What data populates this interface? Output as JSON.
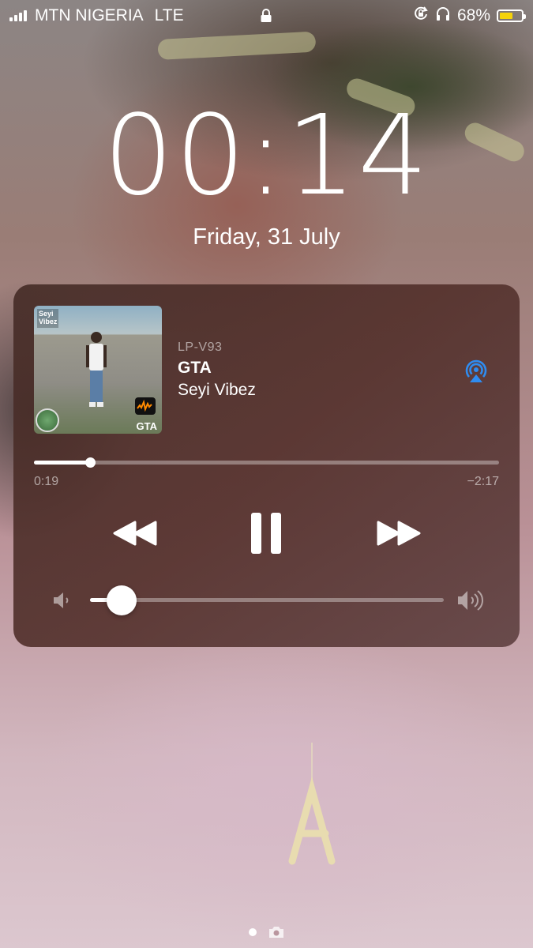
{
  "status_bar": {
    "carrier": "MTN NIGERIA",
    "network": "LTE",
    "battery_percent": "68%",
    "battery_level": 0.68,
    "battery_color": "#f5d20a",
    "icons": [
      "signal-bars-icon",
      "lock-icon",
      "rotation-lock-icon",
      "headphones-icon",
      "battery-icon"
    ]
  },
  "lock_screen": {
    "time": "00:14",
    "date": "Friday, 31 July"
  },
  "now_playing": {
    "artwork_text": "Seyi\nVibez",
    "artwork_badge": "GTA",
    "source": "LP-V93",
    "title": "GTA",
    "artist": "Seyi Vibez",
    "elapsed": "0:19",
    "remaining": "−2:17",
    "progress": 0.12,
    "volume": 0.09,
    "airplay_color": "#2f8cf0",
    "controls": [
      "rewind-icon",
      "pause-icon",
      "fast-forward-icon"
    ]
  },
  "page_indicator": {
    "pages": 2,
    "active": 0,
    "icons": [
      "camera-icon"
    ]
  }
}
